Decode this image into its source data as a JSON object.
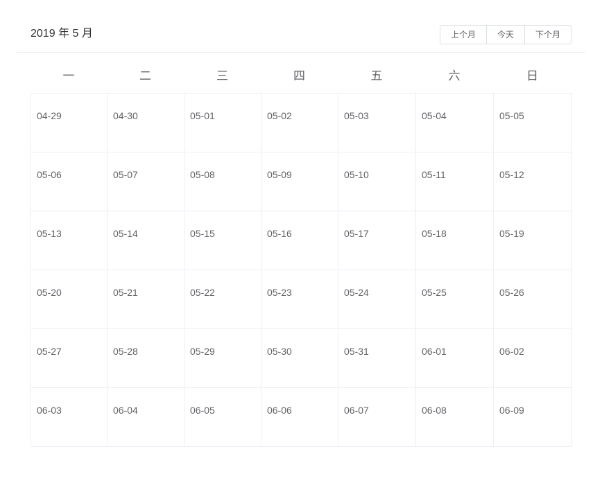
{
  "calendar": {
    "title": "2019 年 5 月",
    "buttons": {
      "prev": "上个月",
      "today": "今天",
      "next": "下个月"
    },
    "weekdays": [
      "一",
      "二",
      "三",
      "四",
      "五",
      "六",
      "日"
    ],
    "weeks": [
      [
        "04-29",
        "04-30",
        "05-01",
        "05-02",
        "05-03",
        "05-04",
        "05-05"
      ],
      [
        "05-06",
        "05-07",
        "05-08",
        "05-09",
        "05-10",
        "05-11",
        "05-12"
      ],
      [
        "05-13",
        "05-14",
        "05-15",
        "05-16",
        "05-17",
        "05-18",
        "05-19"
      ],
      [
        "05-20",
        "05-21",
        "05-22",
        "05-23",
        "05-24",
        "05-25",
        "05-26"
      ],
      [
        "05-27",
        "05-28",
        "05-29",
        "05-30",
        "05-31",
        "06-01",
        "06-02"
      ],
      [
        "06-03",
        "06-04",
        "06-05",
        "06-06",
        "06-07",
        "06-08",
        "06-09"
      ]
    ]
  },
  "colors": {
    "text": "#606266",
    "title": "#303133",
    "border": "#ebeef5",
    "button_border": "#dcdfe6"
  }
}
